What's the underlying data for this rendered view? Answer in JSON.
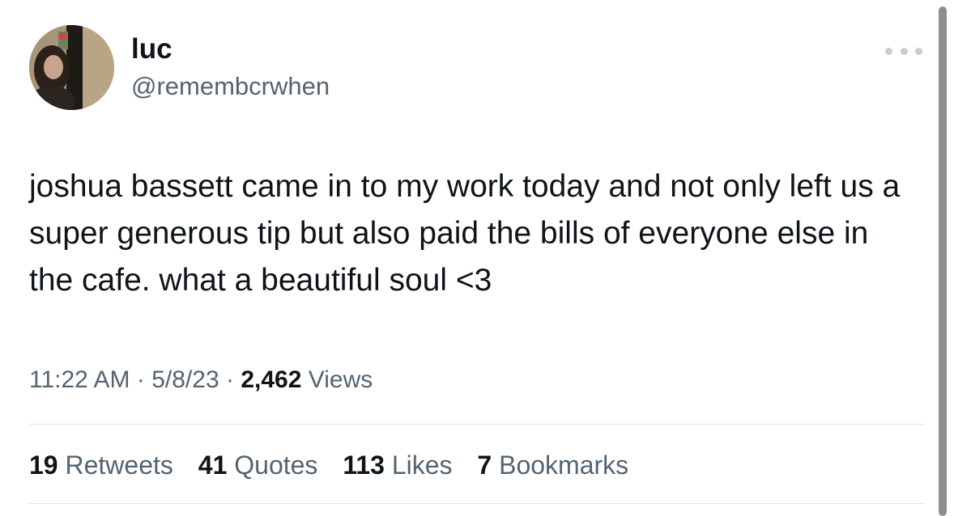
{
  "author": {
    "display_name": "luc",
    "handle": "@remembcrwhen"
  },
  "tweet": {
    "text": "joshua bassett came in to my work today and not only left us a super generous tip but also paid the bills of everyone else in the cafe. what a beautiful soul <3",
    "time": "11:22 AM",
    "date": "5/8/23",
    "separator": "·",
    "views_count": "2,462",
    "views_label": "Views"
  },
  "stats": [
    {
      "count": "19",
      "label": "Retweets"
    },
    {
      "count": "41",
      "label": "Quotes"
    },
    {
      "count": "113",
      "label": "Likes"
    },
    {
      "count": "7",
      "label": "Bookmarks"
    }
  ],
  "icons": {
    "more": "more-horizontal-icon"
  },
  "colors": {
    "primary_text": "#0f1419",
    "secondary_text": "#536471",
    "divider": "#e1e6ea"
  }
}
